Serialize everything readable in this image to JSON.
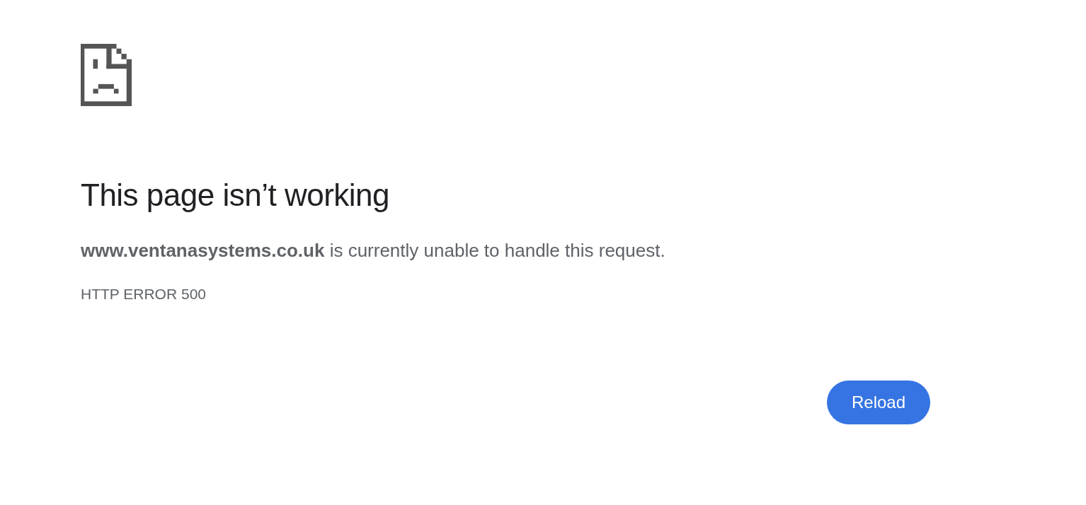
{
  "error_page": {
    "heading": "This page isn’t working",
    "message": "**www.ventanasystems.co.uk** is currently unable to handle this request.",
    "error_code": "HTTP ERROR 500"
  },
  "buttons": [
    {
      "label": "Reload"
    }
  ]
}
